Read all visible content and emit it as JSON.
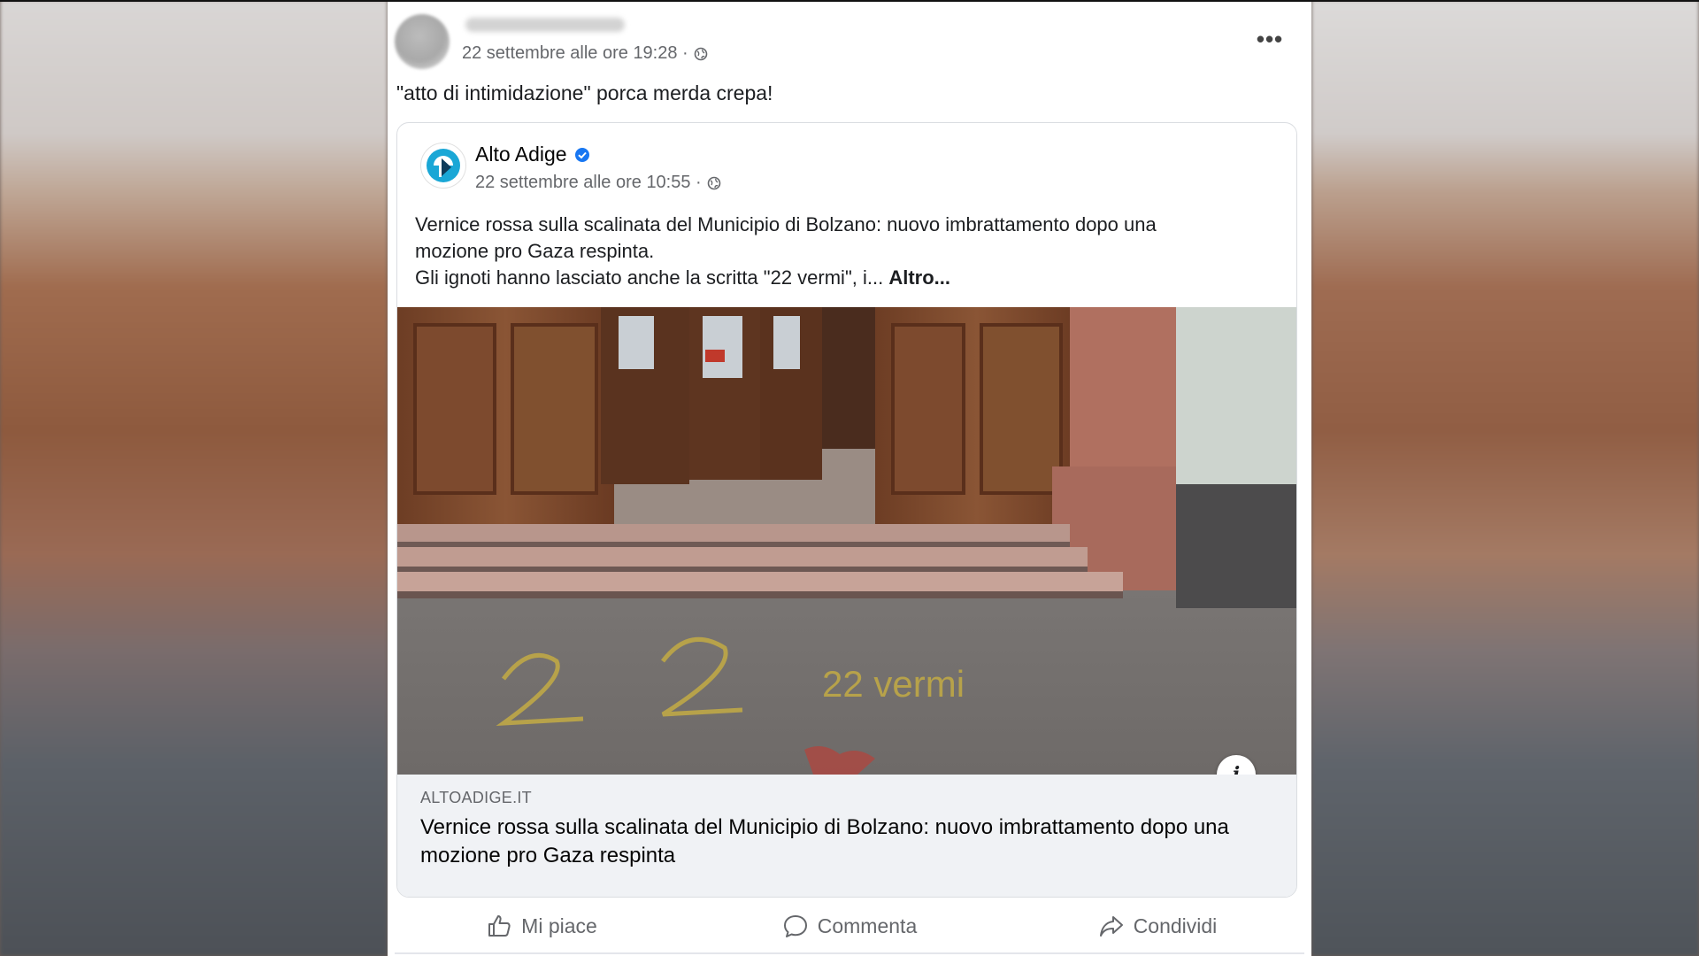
{
  "post": {
    "time": "22 settembre alle ore 19:28 ·",
    "text": "\"atto di intimidazione\" porca merda crepa!",
    "more_label": "•••"
  },
  "shared": {
    "page_name": "Alto Adige",
    "time": "22 settembre alle ore 10:55 ·",
    "text_line1": "Vernice rossa sulla scalinata del Municipio di Bolzano: nuovo imbrattamento dopo una",
    "text_line2": "mozione pro Gaza respinta.",
    "text_line3": "Gli ignoti hanno lasciato anche la scritta \"22 vermi\", i... ",
    "more_link": "Altro...",
    "info_label": "i",
    "photo_graffiti": "22 vermi",
    "link": {
      "domain": "ALTOADIGE.IT",
      "title": "Vernice rossa sulla scalinata del Municipio di Bolzano: nuovo imbrattamento dopo una mozione pro Gaza respinta"
    }
  },
  "actions": {
    "like": "Mi piace",
    "comment": "Commenta",
    "share": "Condividi"
  },
  "icons": {
    "globe": "globe-icon",
    "verified": "verified-badge-icon",
    "like": "thumbs-up-icon",
    "comment": "comment-bubble-icon",
    "share": "share-arrow-icon"
  },
  "colors": {
    "verified": "#1877f2",
    "muted_text": "#65676b",
    "link_preview_bg": "#f0f2f5"
  }
}
